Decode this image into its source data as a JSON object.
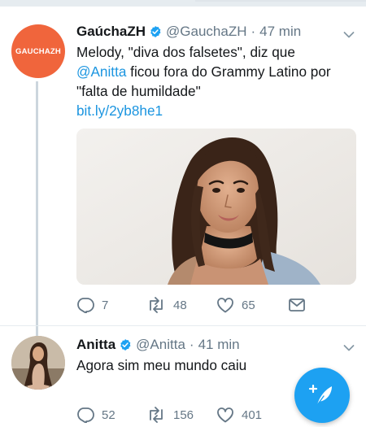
{
  "tweets": [
    {
      "avatar_text": "GAUCHAZH",
      "name": "GaúchaZH",
      "handle": "@GauchaZH",
      "separator": "·",
      "time": "47 min",
      "text_line1": "Melody, \"diva dos falsetes\", diz que",
      "text_mention": "@Anitta",
      "text_line2_rest": " ficou fora do Grammy Latino por",
      "text_line3": "\"falta de humildade\"",
      "link": "bit.ly/2yb8he1",
      "replies": "7",
      "retweets": "48",
      "likes": "65"
    },
    {
      "name": "Anitta",
      "handle": "@Anitta",
      "separator": "·",
      "time": "41 min",
      "text": "Agora sim meu mundo caiu",
      "replies": "52",
      "retweets": "156",
      "likes": "401"
    }
  ],
  "colors": {
    "accent": "#1da1f2",
    "link": "#1b95e0",
    "secondary_text": "#657786",
    "gzh_orange": "#f0653c"
  },
  "icons": [
    "verified-badge-icon",
    "chevron-down-icon",
    "reply-icon",
    "retweet-icon",
    "like-icon",
    "direct-message-icon",
    "compose-tweet-icon"
  ]
}
